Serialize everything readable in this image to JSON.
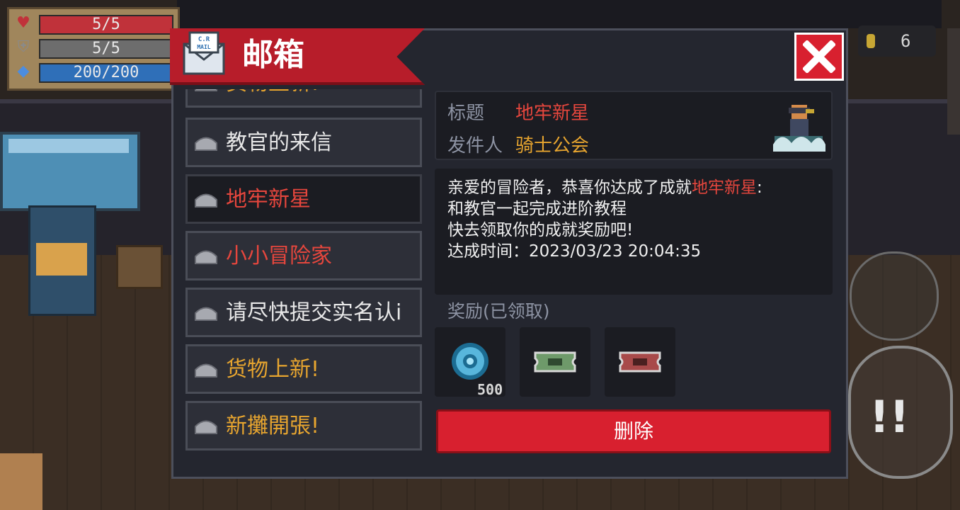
{
  "hud": {
    "hp": "5/5",
    "armor": "5/5",
    "energy": "200/200",
    "colors": {
      "hp": "#c0323a",
      "armor": "#6d6d6d",
      "energy": "#2f6fb8"
    }
  },
  "coins": {
    "value": "6",
    "icon": "coin-icon"
  },
  "mailbox": {
    "title": "邮箱",
    "icon_text": "C.R MAIL",
    "close_icon": "close-x-icon",
    "list": [
      {
        "label": "货物上新!",
        "color": "#e7a52f",
        "partial": true
      },
      {
        "label": "教官的来信",
        "color": "#e8e8e8"
      },
      {
        "label": "地牢新星",
        "color": "#e5463d",
        "selected": true
      },
      {
        "label": "小小冒险家",
        "color": "#e5463d"
      },
      {
        "label": "请尽快提交实名认i",
        "color": "#e8e8e8"
      },
      {
        "label": "货物上新!",
        "color": "#e7a52f"
      },
      {
        "label": "新攤開張!",
        "color": "#e7a52f"
      }
    ],
    "detail": {
      "subject_label": "标题",
      "subject": "地牢新星",
      "sender_label": "发件人",
      "sender": "骑士公会",
      "body_pre": "亲爱的冒险者，恭喜你达成了成就",
      "body_highlight": "地牢新星",
      "body_post": ":",
      "body_lines": [
        "和教官一起完成进阶教程",
        "快去领取你的成就奖励吧!",
        "达成时间：2023/03/23 20:04:35"
      ],
      "rewards_label": "奖励(已领取)",
      "rewards": [
        {
          "icon": "gem-coin-icon",
          "count": "500"
        },
        {
          "icon": "green-ticket-icon",
          "count": ""
        },
        {
          "icon": "red-ticket-icon",
          "count": ""
        }
      ],
      "delete_label": "删除"
    }
  },
  "colors": {
    "accent": "#d8202f",
    "orange": "#e7a52f",
    "red_text": "#e5463d",
    "panel": "#24262f"
  }
}
